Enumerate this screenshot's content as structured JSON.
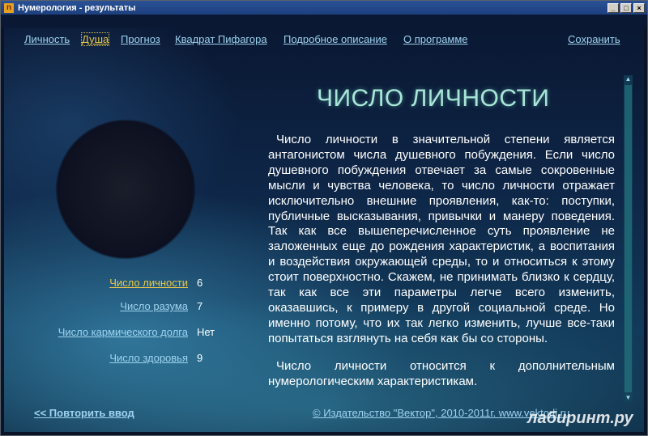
{
  "window": {
    "title": "Нумерология - результаты",
    "min": "_",
    "max": "□",
    "close": "×"
  },
  "menu": [
    "Личность",
    "Душа",
    "Прогноз",
    "Квадрат Пифагора",
    "Подробное описание",
    "О программе"
  ],
  "menu_right": "Сохранить",
  "heading": "ЧИСЛО ЛИЧНОСТИ",
  "paragraphs": [
    "Число личности в значительной степени является антагонистом числа душевного побуждения. Если число душевного побуждения отвечает за самые сокровенные мысли и чувства человека, то число личности отражает исключительно внешние проявления, как-то: поступки, публичные высказывания, привычки и манеру поведения. Так как все вышеперечисленное суть проявление не заложенных еще до рождения характеристик, а воспитания и воздействия окружающей среды, то и относиться к этому стоит поверхностно. Скажем, не принимать близко к сердцу, так как все эти параметры легче всего изменить, оказавшись, к примеру в другой социальной среде. Но именно потому, что их так легко изменить, лучше все-таки попытаться взглянуть на себя как бы со стороны.",
    "Число личности относится к дополнительным нумерологическим характеристикам."
  ],
  "side": [
    {
      "label": "Число личности",
      "value": "6"
    },
    {
      "label": "Число разума",
      "value": "7"
    },
    {
      "label": "Число кармического долга",
      "value": "Нет"
    },
    {
      "label": "Число здоровья",
      "value": "9"
    }
  ],
  "bottom_left": "<< Повторить ввод",
  "bottom_right": "© Издательство \"Вектор\", 2010-2011г. www.vektorli.ru",
  "watermark": "лабиринт.ру",
  "scroll": {
    "up": "▲",
    "down": "▼"
  }
}
